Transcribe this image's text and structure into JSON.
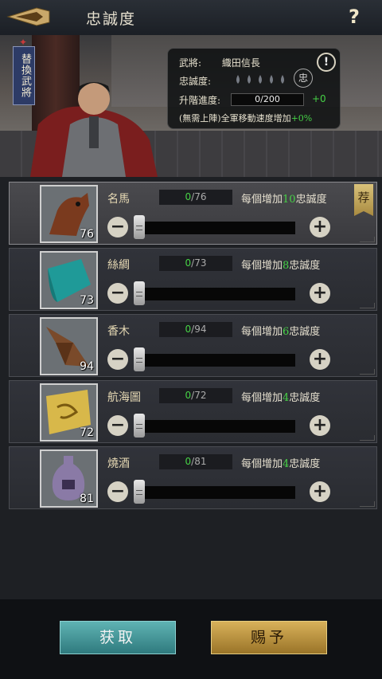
{
  "header": {
    "title": "忠誠度",
    "help_label": "?"
  },
  "banner": {
    "swap_button": "替換武將",
    "general_label": "武將:",
    "general_name": "織田信長",
    "loyalty_label": "忠誠度:",
    "loyalty_seal": "忠",
    "promotion_label": "升階進度:",
    "promotion_value": "0/200",
    "promotion_bonus": "+0",
    "note_prefix": "(無需上陣)全軍移動速度增加",
    "note_bonus": "+0%",
    "warn_icon": "!"
  },
  "items": [
    {
      "name": "名馬",
      "have": "0",
      "need": "/76",
      "desc_prefix": "每個增加",
      "amount": "10",
      "desc_suffix": "忠誠度",
      "qty": "76",
      "recommended": "荐",
      "icon": "horse-icon"
    },
    {
      "name": "絲綢",
      "have": "0",
      "need": "/73",
      "desc_prefix": "每個增加",
      "amount": "8",
      "desc_suffix": "忠誠度",
      "qty": "73",
      "icon": "silk-icon"
    },
    {
      "name": "香木",
      "have": "0",
      "need": "/94",
      "desc_prefix": "每個增加",
      "amount": "6",
      "desc_suffix": "忠誠度",
      "qty": "94",
      "icon": "incense-wood-icon"
    },
    {
      "name": "航海圖",
      "have": "0",
      "need": "/72",
      "desc_prefix": "每個增加",
      "amount": "4",
      "desc_suffix": "忠誠度",
      "qty": "72",
      "icon": "sea-chart-icon"
    },
    {
      "name": "燒酒",
      "have": "0",
      "need": "/81",
      "desc_prefix": "每個增加",
      "amount": "4",
      "desc_suffix": "忠誠度",
      "qty": "81",
      "icon": "liquor-bottle-icon"
    }
  ],
  "controls": {
    "minus": "−",
    "plus": "+"
  },
  "footer": {
    "get_label": "获取",
    "give_label": "赐予"
  },
  "colors": {
    "accent_green": "#46d246",
    "gold_button": "#c9a04a",
    "teal_button": "#4a9a9c"
  }
}
